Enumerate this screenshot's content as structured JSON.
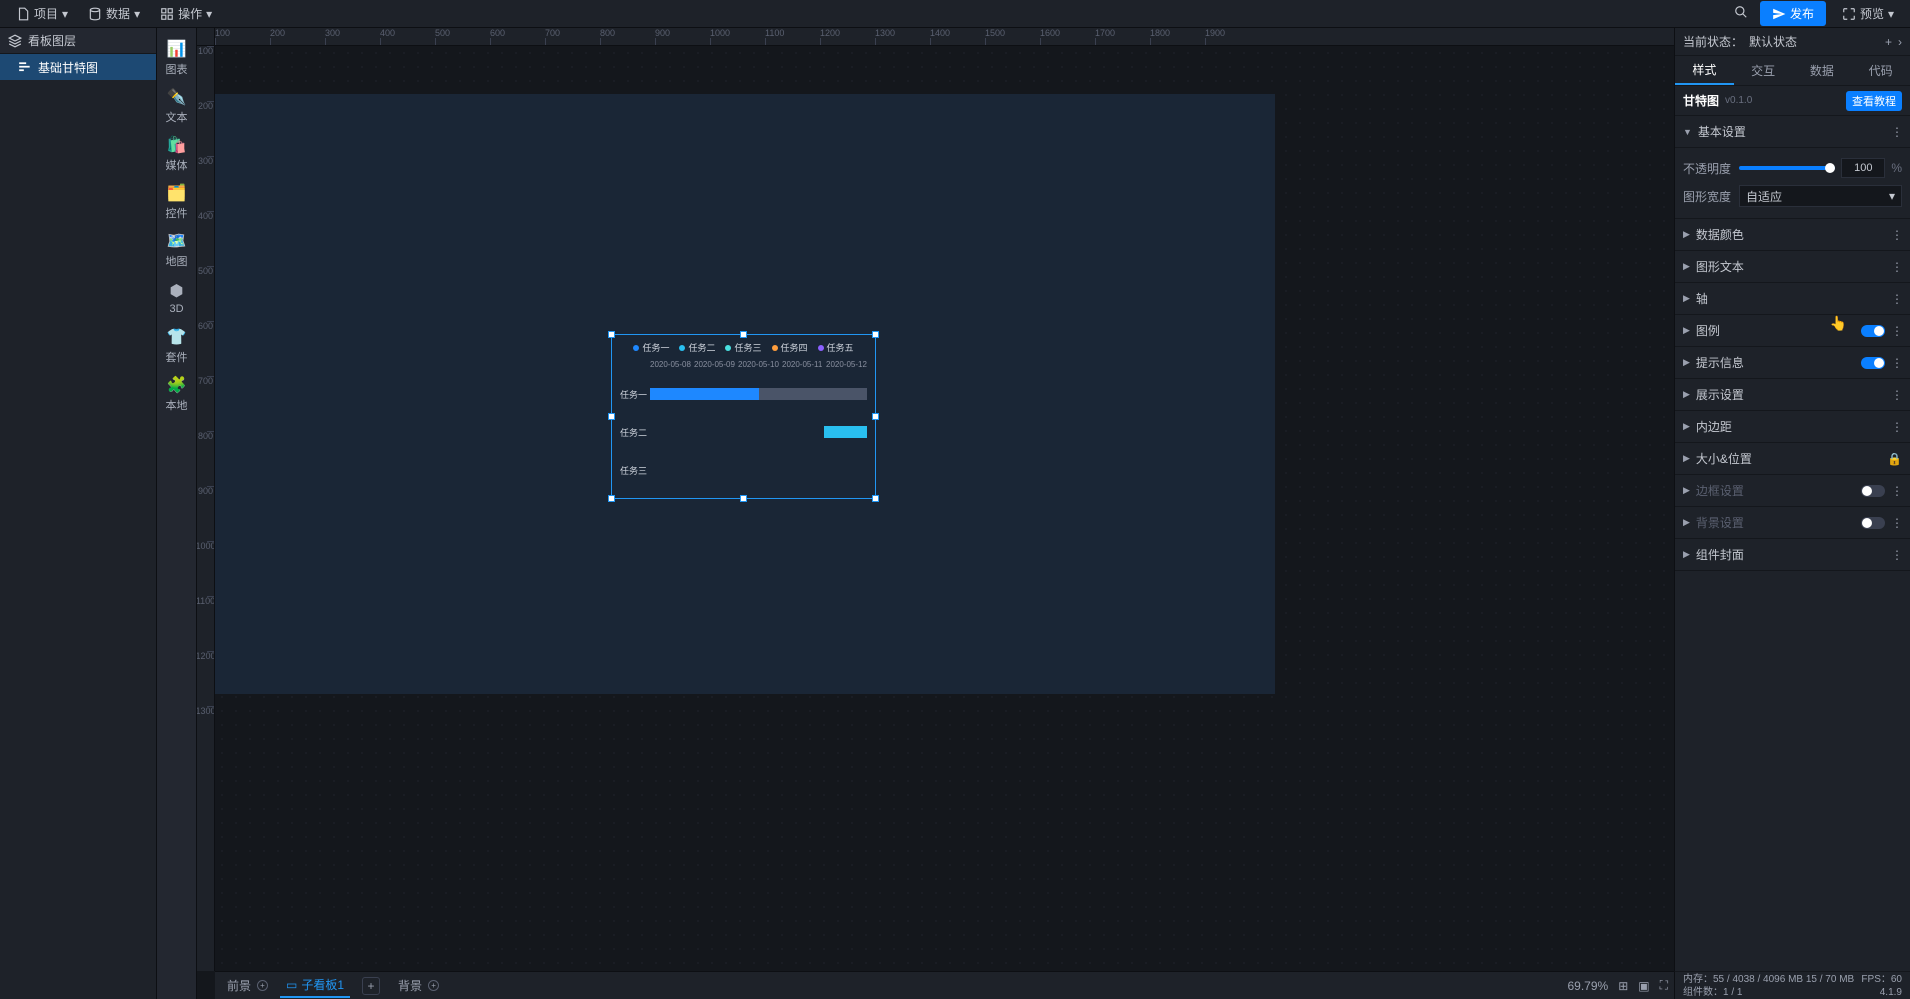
{
  "topbar": {
    "project": "项目",
    "data": "数据",
    "operation": "操作",
    "publish": "发布",
    "preview": "预览"
  },
  "layerPanel": {
    "header": "看板图层",
    "items": [
      "基础甘特图"
    ]
  },
  "iconbar": {
    "items": [
      "图表",
      "文本",
      "媒体",
      "控件",
      "地图",
      "3D",
      "套件",
      "本地"
    ]
  },
  "ruler_h": [
    "100",
    "200",
    "300",
    "400",
    "500",
    "600",
    "700",
    "800",
    "900",
    "1000",
    "1100",
    "1200",
    "1300",
    "1400",
    "1500",
    "1600",
    "1700",
    "1800",
    "1900"
  ],
  "ruler_v": [
    "100",
    "200",
    "300",
    "400",
    "500",
    "600",
    "700",
    "800",
    "900",
    "1000",
    "1100",
    "1200",
    "1300"
  ],
  "chart_data": {
    "type": "gantt",
    "title": "",
    "legend": [
      {
        "name": "任务一",
        "color": "#1e88ff"
      },
      {
        "name": "任务二",
        "color": "#29bff0"
      },
      {
        "name": "任务三",
        "color": "#49e0e0"
      },
      {
        "name": "任务四",
        "color": "#ff9d3c"
      },
      {
        "name": "任务五",
        "color": "#8b60ff"
      }
    ],
    "x_dates": [
      "2020-05-08",
      "2020-05-09",
      "2020-05-10",
      "2020-05-11",
      "2020-05-12"
    ],
    "rows": [
      {
        "label": "任务一",
        "bars": [
          {
            "start": "2020-05-08",
            "end": "2020-05-10",
            "color": "#1e88ff",
            "left_pct": 0,
            "width_pct": 50
          },
          {
            "start": "2020-05-10",
            "end": "2020-05-12",
            "color": "#4a5468",
            "left_pct": 50,
            "width_pct": 50
          }
        ]
      },
      {
        "label": "任务二",
        "bars": [
          {
            "start": "2020-05-11",
            "end": "2020-05-12",
            "color": "#29bff0",
            "left_pct": 80,
            "width_pct": 20
          }
        ]
      },
      {
        "label": "任务三",
        "bars": []
      }
    ]
  },
  "bottomTabs": {
    "foreground": "前景",
    "subboard": "子看板1",
    "background": "背景",
    "zoom": "69.79%"
  },
  "propPanel": {
    "stateLabel": "当前状态：",
    "stateValue": "默认状态",
    "tabs": [
      "样式",
      "交互",
      "数据",
      "代码"
    ],
    "componentName": "甘特图",
    "version": "v0.1.0",
    "tutorial": "查看教程",
    "sections": {
      "basic": "基本设置",
      "opacity_label": "不透明度",
      "opacity_value": "100",
      "opacity_unit": "%",
      "width_label": "图形宽度",
      "width_value": "自适应",
      "dataColor": "数据颜色",
      "graphText": "图形文本",
      "axis": "轴",
      "legend": "图例",
      "tooltip": "提示信息",
      "display": "展示设置",
      "padding": "内边距",
      "sizePos": "大小&位置",
      "border": "边框设置",
      "bg": "背景设置",
      "cover": "组件封面"
    }
  },
  "status": {
    "mem_label": "内存：",
    "mem_value": "55 / 4038 / 4096 MB  15 / 70 MB",
    "fps_label": "FPS：",
    "fps_value": "60",
    "comp_label": "组件数：",
    "comp_value": "1 / 1",
    "version": "4.1.9"
  }
}
